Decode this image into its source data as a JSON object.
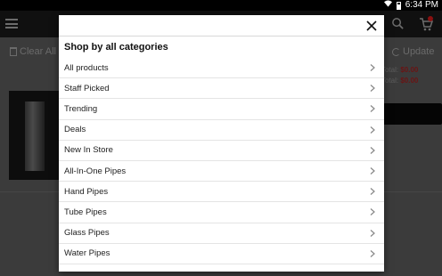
{
  "status_bar": {
    "time": "6:34 PM"
  },
  "page": {
    "clear_all_label": "Clear All",
    "update_label": "Update",
    "totals": [
      {
        "label": "Total:",
        "value": "$0.00"
      },
      {
        "label": "Total:",
        "value": "$0.00"
      }
    ]
  },
  "dialog": {
    "title": "Shop by all categories",
    "close_glyph": "✕",
    "categories": [
      "All products",
      "Staff Picked",
      "Trending",
      "Deals",
      "New In Store",
      "All-In-One Pipes",
      "Hand Pipes",
      "Tube Pipes",
      "Glass Pipes",
      "Water Pipes"
    ]
  },
  "icons": {
    "menu": "hamburger-icon",
    "search": "search-icon",
    "cart": "cart-icon",
    "close": "close-icon",
    "chevron": "chevron-right-icon"
  },
  "colors": {
    "accent_red": "#d32f2f",
    "overlay": "#3b3b3b"
  }
}
